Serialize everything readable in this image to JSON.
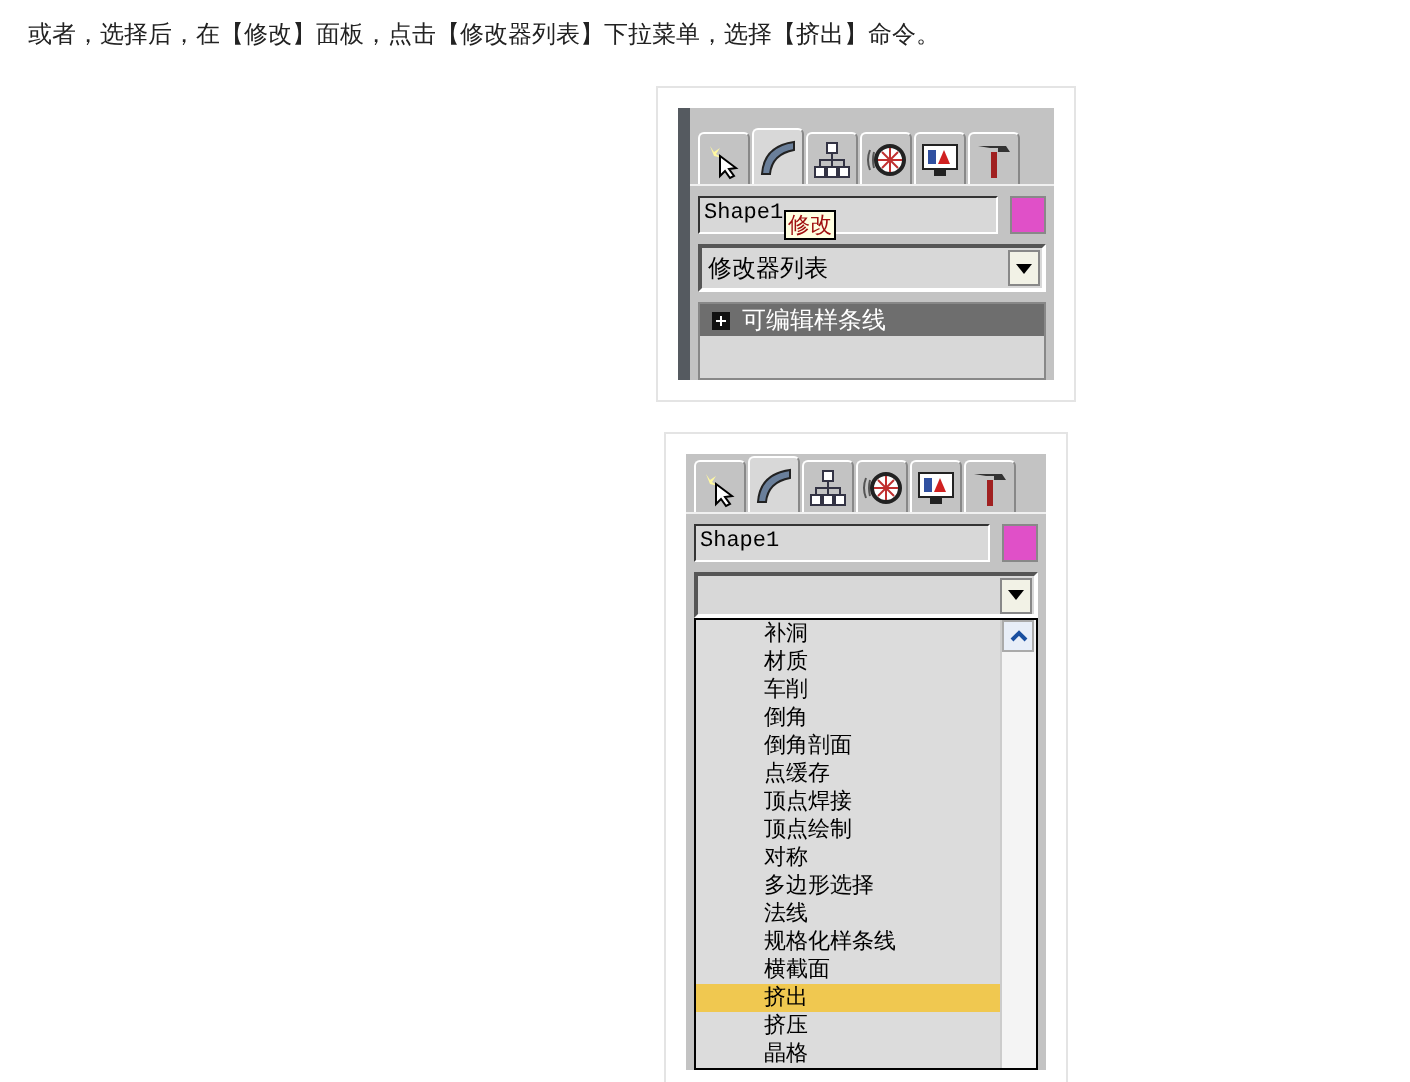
{
  "intro": "或者，选择后，在【修改】面板，点击【修改器列表】下拉菜单，选择【挤出】命令。",
  "figures": [
    {
      "tabs": [
        {
          "kind": "create",
          "selected": false
        },
        {
          "kind": "modify",
          "selected": true
        },
        {
          "kind": "hierarchy",
          "selected": false
        },
        {
          "kind": "motion",
          "selected": false
        },
        {
          "kind": "display",
          "selected": false
        },
        {
          "kind": "utilities",
          "selected": false
        }
      ],
      "name": "Shape1",
      "color": "#e050c8",
      "tooltip": "修改",
      "dropdown": "修改器列表",
      "stack": [
        {
          "label": "可编辑样条线"
        }
      ]
    },
    {
      "tabs": [
        {
          "kind": "create",
          "selected": false
        },
        {
          "kind": "modify",
          "selected": true
        },
        {
          "kind": "hierarchy",
          "selected": false
        },
        {
          "kind": "motion",
          "selected": false
        },
        {
          "kind": "display",
          "selected": false
        },
        {
          "kind": "utilities",
          "selected": false
        }
      ],
      "name": "Shape1",
      "color": "#e050c8",
      "options": [
        {
          "label": "补洞",
          "selected": false
        },
        {
          "label": "材质",
          "selected": false
        },
        {
          "label": "车削",
          "selected": false
        },
        {
          "label": "倒角",
          "selected": false
        },
        {
          "label": "倒角剖面",
          "selected": false
        },
        {
          "label": "点缓存",
          "selected": false
        },
        {
          "label": "顶点焊接",
          "selected": false
        },
        {
          "label": "顶点绘制",
          "selected": false
        },
        {
          "label": "对称",
          "selected": false
        },
        {
          "label": "多边形选择",
          "selected": false
        },
        {
          "label": "法线",
          "selected": false
        },
        {
          "label": "规格化样条线",
          "selected": false
        },
        {
          "label": "横截面",
          "selected": false
        },
        {
          "label": "挤出",
          "selected": true
        },
        {
          "label": "挤压",
          "selected": false
        },
        {
          "label": "晶格",
          "selected": false
        }
      ]
    }
  ]
}
